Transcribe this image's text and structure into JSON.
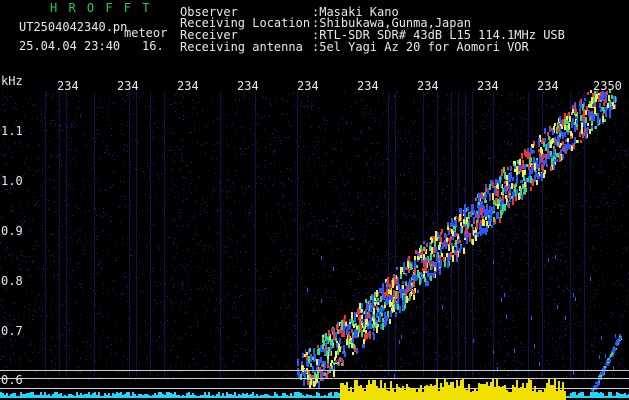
{
  "header": {
    "brand": "H R O F F T",
    "filename": "UT2504042340.pn",
    "meteor_label": "meteor",
    "datetime": "25.04.04 23:40",
    "count": "16."
  },
  "info": {
    "labels": [
      "Observer",
      "Receiving Location",
      "Receiver",
      "Receiving antenna"
    ],
    "values": [
      ":Masaki Kano",
      ":Shibukawa,Gunma,Japan",
      ":RTL-SDR SDR# 43dB L15 114.1MHz USB",
      ":5el Yagi Az 20 for Aomori VOR"
    ]
  },
  "axis": {
    "unit": "kHz",
    "y_ticks": [
      "1.1",
      "1.0",
      "0.9",
      "0.8",
      "0.7",
      "0.6"
    ],
    "x_ticks": [
      "234",
      "234",
      "234",
      "234",
      "234",
      "234",
      "234",
      "234",
      "234",
      "2350"
    ]
  },
  "colors": {
    "background": "#000000",
    "noise": "#1a1f8a",
    "trace_blue": "#2a58ff",
    "trace_green": "#30e070",
    "trace_yellow": "#f0f040",
    "trace_red": "#ff3030",
    "baseline_yellow": "#f0e000",
    "baseline_cyan": "#20d8ff",
    "grid_line": "#cfcfcf"
  }
}
